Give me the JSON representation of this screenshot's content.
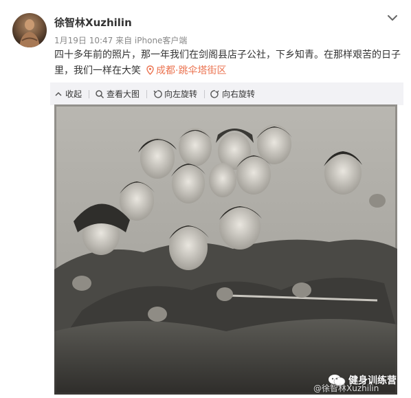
{
  "post": {
    "username": "徐智林Xuzhilin",
    "meta": "1月19日 10:47 来自 iPhone客户端",
    "text": "四十多年前的照片，那一年我们在剑阁县店子公社，下乡知青。在那样艰苦的日子里，我们一样在大笑",
    "location": "成都·跳伞塔街区"
  },
  "toolbar": {
    "items": [
      {
        "label": "收起",
        "icon": "collapse-icon"
      },
      {
        "label": "查看大图",
        "icon": "zoom-icon"
      },
      {
        "label": "向左旋转",
        "icon": "rotate-left-icon"
      },
      {
        "label": "向右旋转",
        "icon": "rotate-right-icon"
      }
    ]
  },
  "photo": {
    "watermark": "健身训练营",
    "watermark_handle": "@徐智林Xuzhilin"
  },
  "colors": {
    "location": "#eb7350",
    "toolbar_bg": "#f2f2f5",
    "text": "#333333",
    "meta": "#888888"
  }
}
